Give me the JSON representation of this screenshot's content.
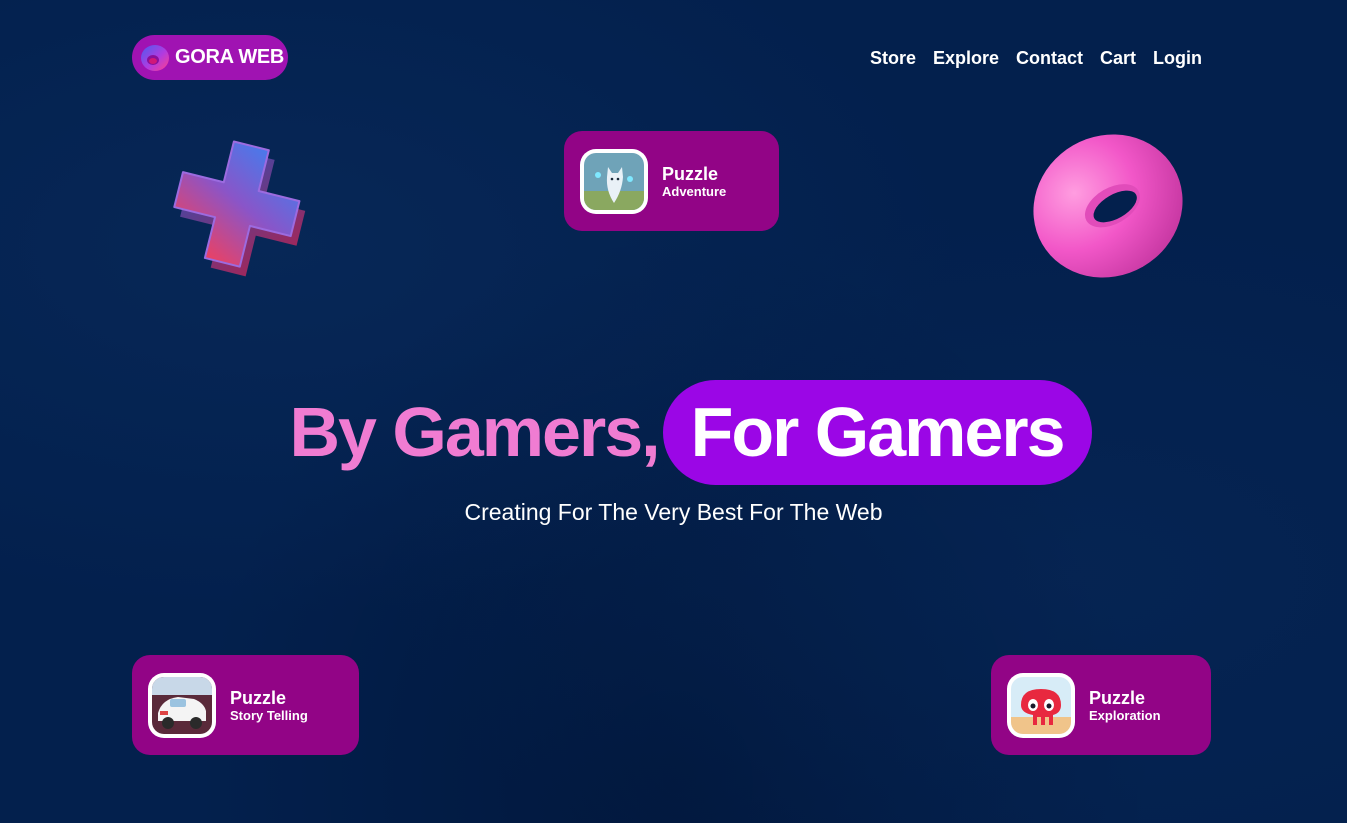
{
  "brand": {
    "name": "GORA WEB",
    "logo_icon": "torus-logo-icon"
  },
  "nav": {
    "items": [
      "Store",
      "Explore",
      "Contact",
      "Cart",
      "Login"
    ]
  },
  "decorations": {
    "left_shape": "plus-3d-icon",
    "right_shape": "torus-3d-icon"
  },
  "cards": [
    {
      "title": "Puzzle",
      "subtitle": "Adventure",
      "thumbnail": "wolf-game-thumbnail"
    },
    {
      "title": "Puzzle",
      "subtitle": "Story Telling",
      "thumbnail": "car-game-thumbnail"
    },
    {
      "title": "Puzzle",
      "subtitle": "Exploration",
      "thumbnail": "creature-game-thumbnail"
    }
  ],
  "hero": {
    "heading_part1": "By Gamers,",
    "heading_part2": "For Gamers",
    "subheading": "Creating For The Very Best For The Web"
  },
  "colors": {
    "background": "#03204d",
    "brand_purple": "#a013b2",
    "card_magenta": "#920486",
    "pill_violet": "#9b06e6",
    "hero_pink": "#f07cd2"
  }
}
